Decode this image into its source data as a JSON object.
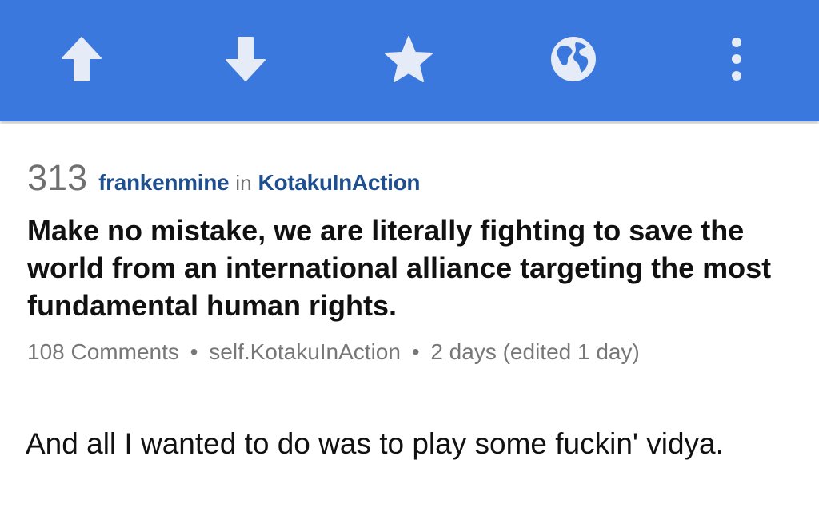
{
  "toolbar": {
    "background": "#3a78dd",
    "icon_color": "#e6ecf7",
    "buttons": [
      {
        "icon": "upvote-arrow-icon"
      },
      {
        "icon": "downvote-arrow-icon"
      },
      {
        "icon": "star-icon"
      },
      {
        "icon": "globe-icon"
      },
      {
        "icon": "more-vertical-icon"
      }
    ]
  },
  "post": {
    "score": "313",
    "author": "frankenmine",
    "in_word": "in",
    "subreddit": "KotakuInAction",
    "title": "Make no mistake, we are literally fighting to save the world from an international alliance targeting the most fundamental human rights.",
    "comments": "108 Comments",
    "separator": "•",
    "domain": "self.KotakuInAction",
    "age": "2 days (edited 1 day)",
    "selftext": "And all I wanted to do was to play some fuckin' vidya."
  },
  "colors": {
    "author_link": "#1f4f8f",
    "meta_text": "#777777",
    "title_text": "#111111"
  }
}
